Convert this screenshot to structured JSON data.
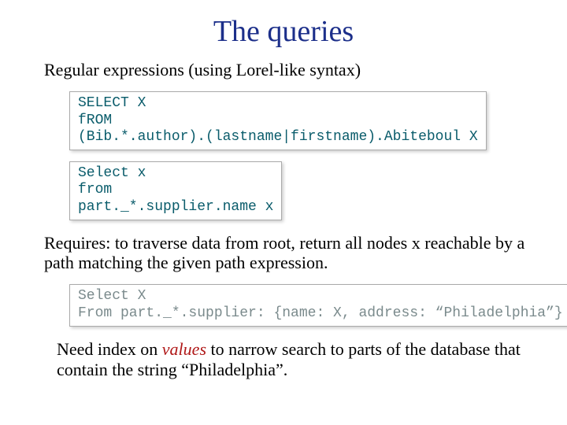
{
  "title": "The queries",
  "intro": "Regular expressions (using Lorel-like syntax)",
  "code1": "SELECT X\nfROM\n(Bib.*.author).(lastname|firstname).Abiteboul X",
  "code2": "Select x\nfrom\npart._*.supplier.name x",
  "requires": "Requires: to traverse data from root, return all nodes x reachable by a path matching the given path expression.",
  "code3": "Select X\nFrom part._*.supplier: {name: X, address: “Philadelphia”}",
  "closing_pre": "Need index on ",
  "closing_em": "values",
  "closing_post": " to narrow search to parts of the database that contain the string “Philadelphia”."
}
